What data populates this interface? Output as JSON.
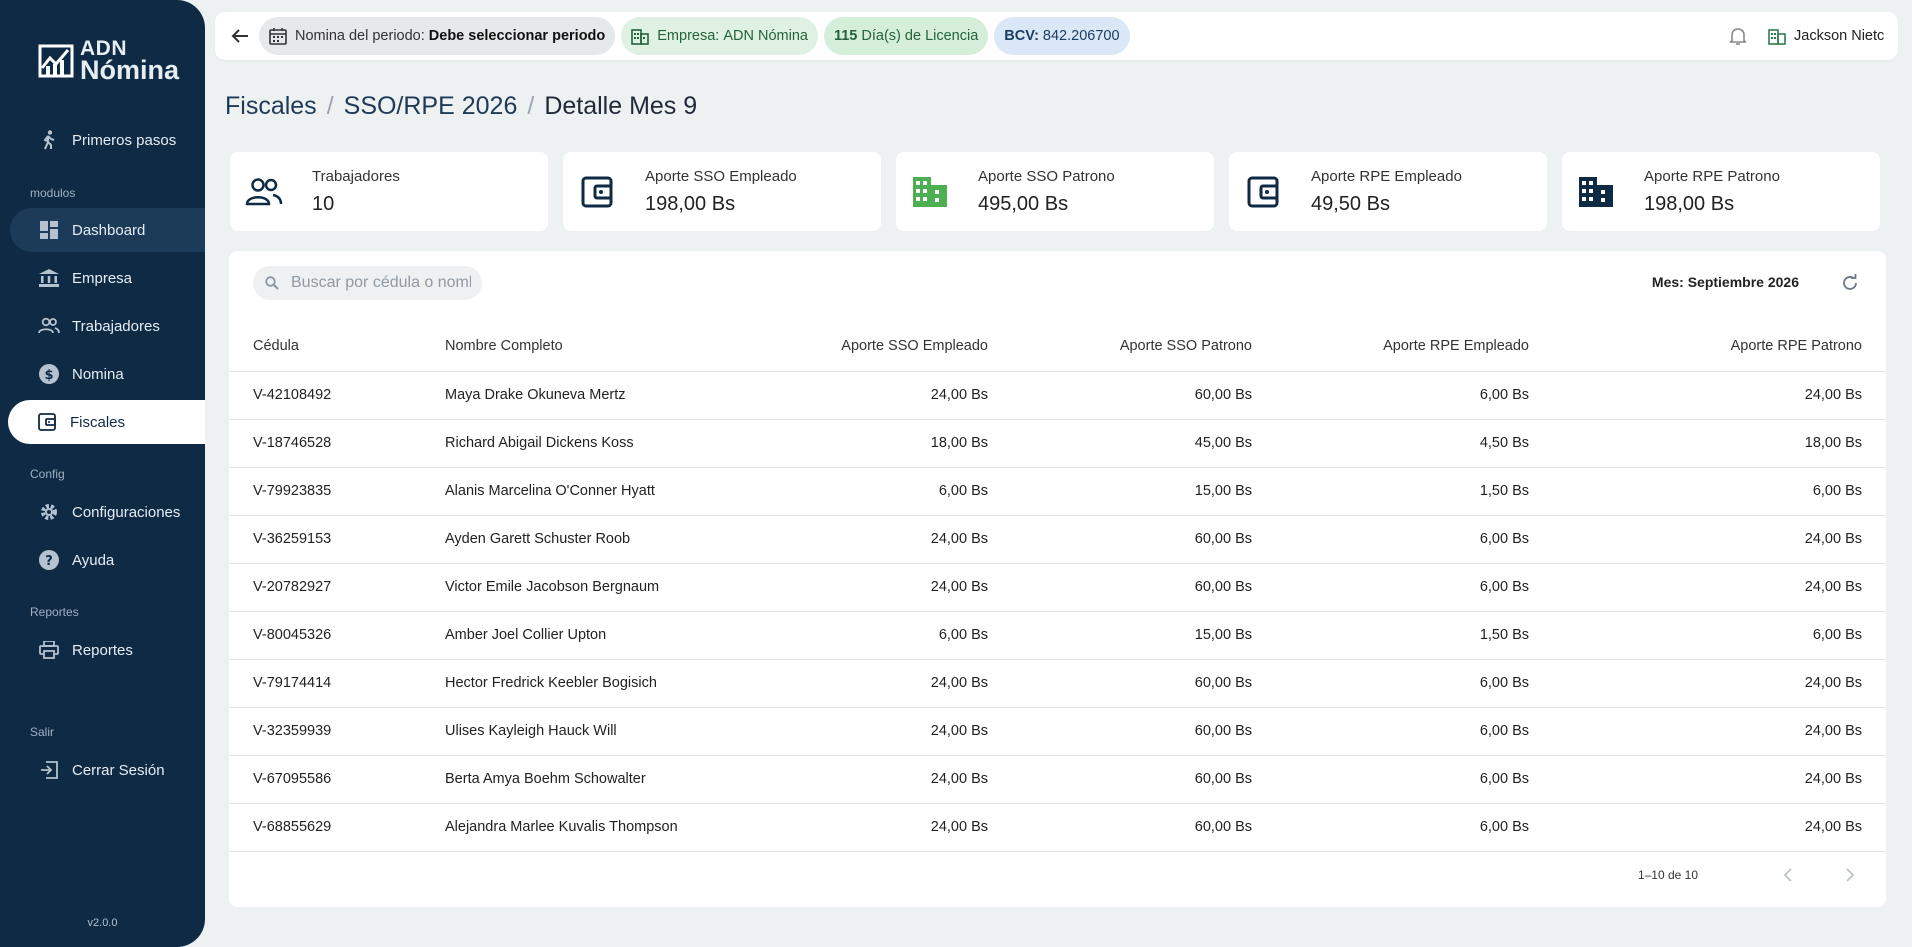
{
  "app": {
    "logo_line1": "ADN",
    "logo_line2": "Nómina",
    "version": "v2.0.0"
  },
  "sidebar": {
    "items": [
      {
        "label": "Primeros pasos",
        "icon": "walk-icon"
      },
      {
        "label": "Dashboard",
        "icon": "dashboard-icon"
      },
      {
        "label": "Empresa",
        "icon": "bank-icon"
      },
      {
        "label": "Trabajadores",
        "icon": "people-icon"
      },
      {
        "label": "Nomina",
        "icon": "dollar-icon"
      },
      {
        "label": "Fiscales",
        "icon": "wallet-icon"
      },
      {
        "label": "Configuraciones",
        "icon": "gear-icon"
      },
      {
        "label": "Ayuda",
        "icon": "help-icon"
      },
      {
        "label": "Reportes",
        "icon": "printer-icon"
      },
      {
        "label": "Cerrar Sesión",
        "icon": "logout-icon"
      }
    ],
    "sections": [
      "modulos",
      "Config",
      "Reportes",
      "Salir"
    ]
  },
  "topbar": {
    "periodo_label": "Nomina del periodo:",
    "periodo_value": "Debe seleccionar periodo",
    "empresa_label": "Empresa:",
    "empresa_value": "ADN Nómina",
    "licencia_days": "115",
    "licencia_label": "Día(s) de Licencia",
    "bcv_label": "BCV:",
    "bcv_value": "842.206700",
    "user_name": "Jackson Nietc"
  },
  "breadcrumb": [
    "Fiscales",
    "SSO/RPE 2026",
    "Detalle Mes 9"
  ],
  "cards": [
    {
      "title": "Trabajadores",
      "value": "10"
    },
    {
      "title": "Aporte SSO Empleado",
      "value": "198,00 Bs"
    },
    {
      "title": "Aporte SSO Patrono",
      "value": "495,00 Bs"
    },
    {
      "title": "Aporte RPE Empleado",
      "value": "49,50 Bs"
    },
    {
      "title": "Aporte RPE Patrono",
      "value": "198,00 Bs"
    }
  ],
  "table": {
    "search_placeholder": "Buscar por cédula o nombre...",
    "mes_label": "Mes: Septiembre 2026",
    "headers": [
      "Cédula",
      "Nombre Completo",
      "Aporte SSO Empleado",
      "Aporte SSO Patrono",
      "Aporte RPE Empleado",
      "Aporte RPE Patrono"
    ],
    "rows": [
      [
        "V-42108492",
        "Maya Drake Okuneva Mertz",
        "24,00 Bs",
        "60,00 Bs",
        "6,00 Bs",
        "24,00 Bs"
      ],
      [
        "V-18746528",
        "Richard Abigail Dickens Koss",
        "18,00 Bs",
        "45,00 Bs",
        "4,50 Bs",
        "18,00 Bs"
      ],
      [
        "V-79923835",
        "Alanis Marcelina O'Conner Hyatt",
        "6,00 Bs",
        "15,00 Bs",
        "1,50 Bs",
        "6,00 Bs"
      ],
      [
        "V-36259153",
        "Ayden Garett Schuster Roob",
        "24,00 Bs",
        "60,00 Bs",
        "6,00 Bs",
        "24,00 Bs"
      ],
      [
        "V-20782927",
        "Victor Emile Jacobson Bergnaum",
        "24,00 Bs",
        "60,00 Bs",
        "6,00 Bs",
        "24,00 Bs"
      ],
      [
        "V-80045326",
        "Amber Joel Collier Upton",
        "6,00 Bs",
        "15,00 Bs",
        "1,50 Bs",
        "6,00 Bs"
      ],
      [
        "V-79174414",
        "Hector Fredrick Keebler Bogisich",
        "24,00 Bs",
        "60,00 Bs",
        "6,00 Bs",
        "24,00 Bs"
      ],
      [
        "V-32359939",
        "Ulises Kayleigh Hauck Will",
        "24,00 Bs",
        "60,00 Bs",
        "6,00 Bs",
        "24,00 Bs"
      ],
      [
        "V-67095586",
        "Berta Amya Boehm Schowalter",
        "24,00 Bs",
        "60,00 Bs",
        "6,00 Bs",
        "24,00 Bs"
      ],
      [
        "V-68855629",
        "Alejandra Marlee Kuvalis Thompson",
        "24,00 Bs",
        "60,00 Bs",
        "6,00 Bs",
        "24,00 Bs"
      ]
    ],
    "pagination": "1–10 de 10"
  },
  "colors": {
    "sidebar_bg": "#0f2a44",
    "page_bg": "#eef1f2",
    "green_accent": "#4caf50",
    "navy_accent": "#0f2a44"
  }
}
